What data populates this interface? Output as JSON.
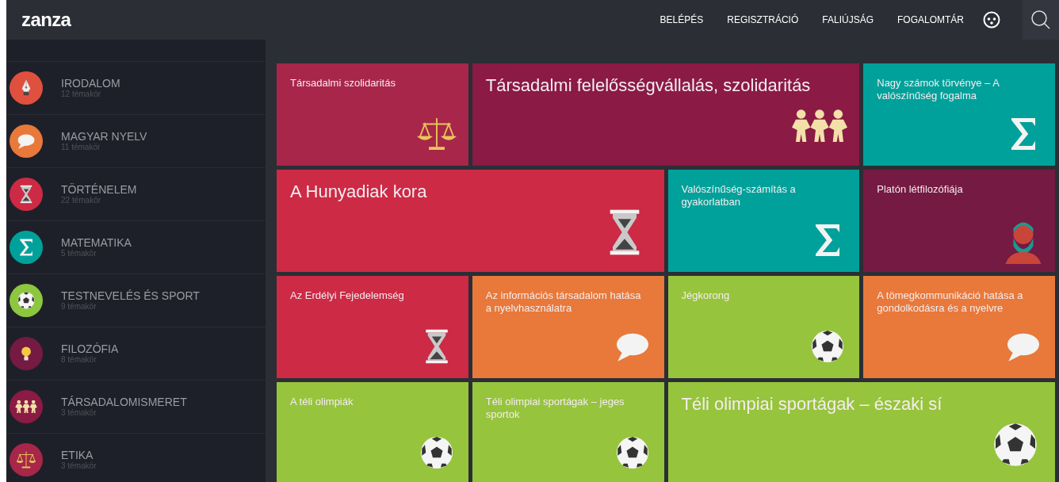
{
  "header": {
    "logo": "zanza",
    "nav": [
      "BELÉPÉS",
      "REGISZTRÁCIÓ",
      "FALIÚJSÁG",
      "FOGALOMTÁR"
    ]
  },
  "sidebar": {
    "items": [
      {
        "name": "IRODALOM",
        "count": "12 témakör",
        "color": "#e0503f",
        "kind": "pen"
      },
      {
        "name": "MAGYAR NYELV",
        "count": "11 témakör",
        "color": "#e8793a",
        "kind": "bubble"
      },
      {
        "name": "TÖRTÉNELEM",
        "count": "22 témakör",
        "color": "#cc2a45",
        "kind": "hourglass"
      },
      {
        "name": "MATEMATIKA",
        "count": "5 témakör",
        "color": "#00a19a",
        "kind": "sigma"
      },
      {
        "name": "TESTNEVELÉS ÉS SPORT",
        "count": "9 témakör",
        "color": "#8dc63f",
        "kind": "ball"
      },
      {
        "name": "FILOZÓFIA",
        "count": "8 témakör",
        "color": "#741a43",
        "kind": "bulb"
      },
      {
        "name": "TÁRSADALOMISMERET",
        "count": "3 témakör",
        "color": "#8b1a45",
        "kind": "people"
      },
      {
        "name": "ETIKA",
        "count": "3 témakör",
        "color": "#a8264a",
        "kind": "scales"
      }
    ]
  },
  "tiles": [
    {
      "title": "Társadalmi szolidaritás",
      "color": "#a8264a",
      "kind": "scales",
      "large": false
    },
    {
      "title": "Társadalmi felelősségvállalás, szolidaritás",
      "color": "#8b1a45",
      "kind": "people",
      "large": true
    },
    {
      "title": "Nagy számok törvénye – A valószínűség fogalma",
      "color": "#00a19a",
      "kind": "sigma",
      "large": false
    },
    {
      "title": "A Hunyadiak kora",
      "color": "#cc2a45",
      "kind": "hourglass",
      "large": true
    },
    {
      "title": "Valószínűség-számítás a gyakorlatban",
      "color": "#00a19a",
      "kind": "sigma",
      "large": false
    },
    {
      "title": "Platón létfilozófiája",
      "color": "#741a43",
      "kind": "bust",
      "large": false
    },
    {
      "title": "Az Erdélyi Fejedelemség",
      "color": "#cc2a45",
      "kind": "hourglass",
      "large": false
    },
    {
      "title": "Az információs társadalom hatása a nyelvhasználatra",
      "color": "#e8793a",
      "kind": "bubble",
      "large": false
    },
    {
      "title": "Jégkorong",
      "color": "#96c43c",
      "kind": "ball",
      "large": false
    },
    {
      "title": "A tömegkommunikáció hatása a gondolkodásra és a nyelvre",
      "color": "#e8793a",
      "kind": "bubble",
      "large": false
    },
    {
      "title": "A téli olimpiák",
      "color": "#96c43c",
      "kind": "ball",
      "large": false
    },
    {
      "title": "Téli olimpiai sportágak – jeges sportok",
      "color": "#96c43c",
      "kind": "ball",
      "large": false
    },
    {
      "title": "Téli olimpiai sportágak – északi sí",
      "color": "#96c43c",
      "kind": "ball",
      "large": true
    }
  ]
}
